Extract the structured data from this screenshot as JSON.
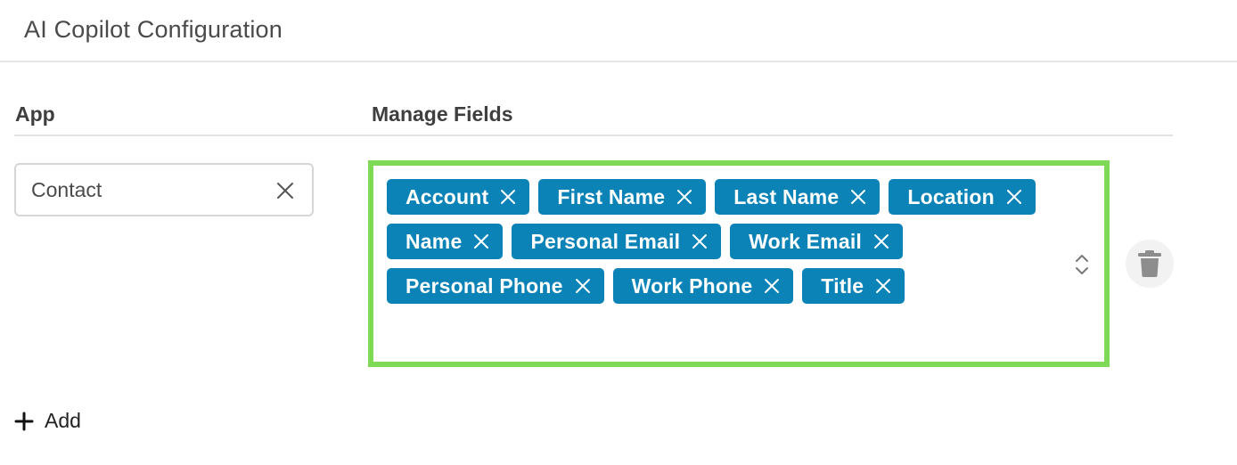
{
  "page": {
    "title": "AI Copilot Configuration"
  },
  "table": {
    "headers": {
      "app": "App",
      "fields": "Manage Fields"
    }
  },
  "row": {
    "app_value": "Contact",
    "fields": [
      "Account",
      "First Name",
      "Last Name",
      "Location",
      "Name",
      "Personal Email",
      "Work Email",
      "Personal Phone",
      "Work Phone",
      "Title"
    ]
  },
  "actions": {
    "add_label": "Add"
  },
  "colors": {
    "chip_background": "#0b83b7",
    "highlight_border": "#7ed957"
  },
  "icons": {
    "chip_remove": "close-icon",
    "app_clear": "close-icon",
    "sort": "chevron-up-down-icon",
    "delete": "trash-icon",
    "add": "plus-icon"
  }
}
